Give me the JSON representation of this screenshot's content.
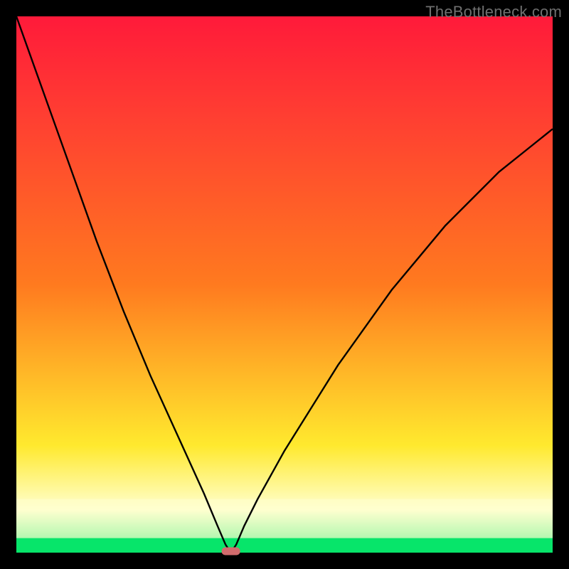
{
  "watermark": "TheBottleneck.com",
  "colors": {
    "black": "#000000",
    "red": "#ff1a3a",
    "orange": "#ff7a1f",
    "yellow": "#ffe92e",
    "paleYellow": "#ffffcf",
    "green": "#07e56a",
    "marker": "#d26b6d",
    "curve": "#000000"
  },
  "layout": {
    "outer": 800,
    "frame": 23,
    "inner": 754,
    "greenBandTop": 0.973,
    "paleBandTop": 0.9
  },
  "chart_data": {
    "type": "line",
    "title": "",
    "xlabel": "",
    "ylabel": "",
    "x_range": [
      0,
      1
    ],
    "y_range": [
      0,
      1
    ],
    "ylim": [
      0,
      1
    ],
    "grid": false,
    "legend": false,
    "marker": {
      "x": 0.4,
      "y": 0.0,
      "label": ""
    },
    "series": [
      {
        "name": "bottleneck-curve",
        "x": [
          0.0,
          0.05,
          0.1,
          0.15,
          0.2,
          0.25,
          0.3,
          0.35,
          0.375,
          0.39,
          0.4,
          0.41,
          0.425,
          0.45,
          0.5,
          0.55,
          0.6,
          0.65,
          0.7,
          0.75,
          0.8,
          0.85,
          0.9,
          0.95,
          1.0
        ],
        "y": [
          1.0,
          0.86,
          0.72,
          0.58,
          0.45,
          0.33,
          0.22,
          0.11,
          0.05,
          0.015,
          0.0,
          0.015,
          0.05,
          0.1,
          0.19,
          0.27,
          0.35,
          0.42,
          0.49,
          0.55,
          0.61,
          0.66,
          0.71,
          0.75,
          0.79
        ]
      }
    ]
  }
}
